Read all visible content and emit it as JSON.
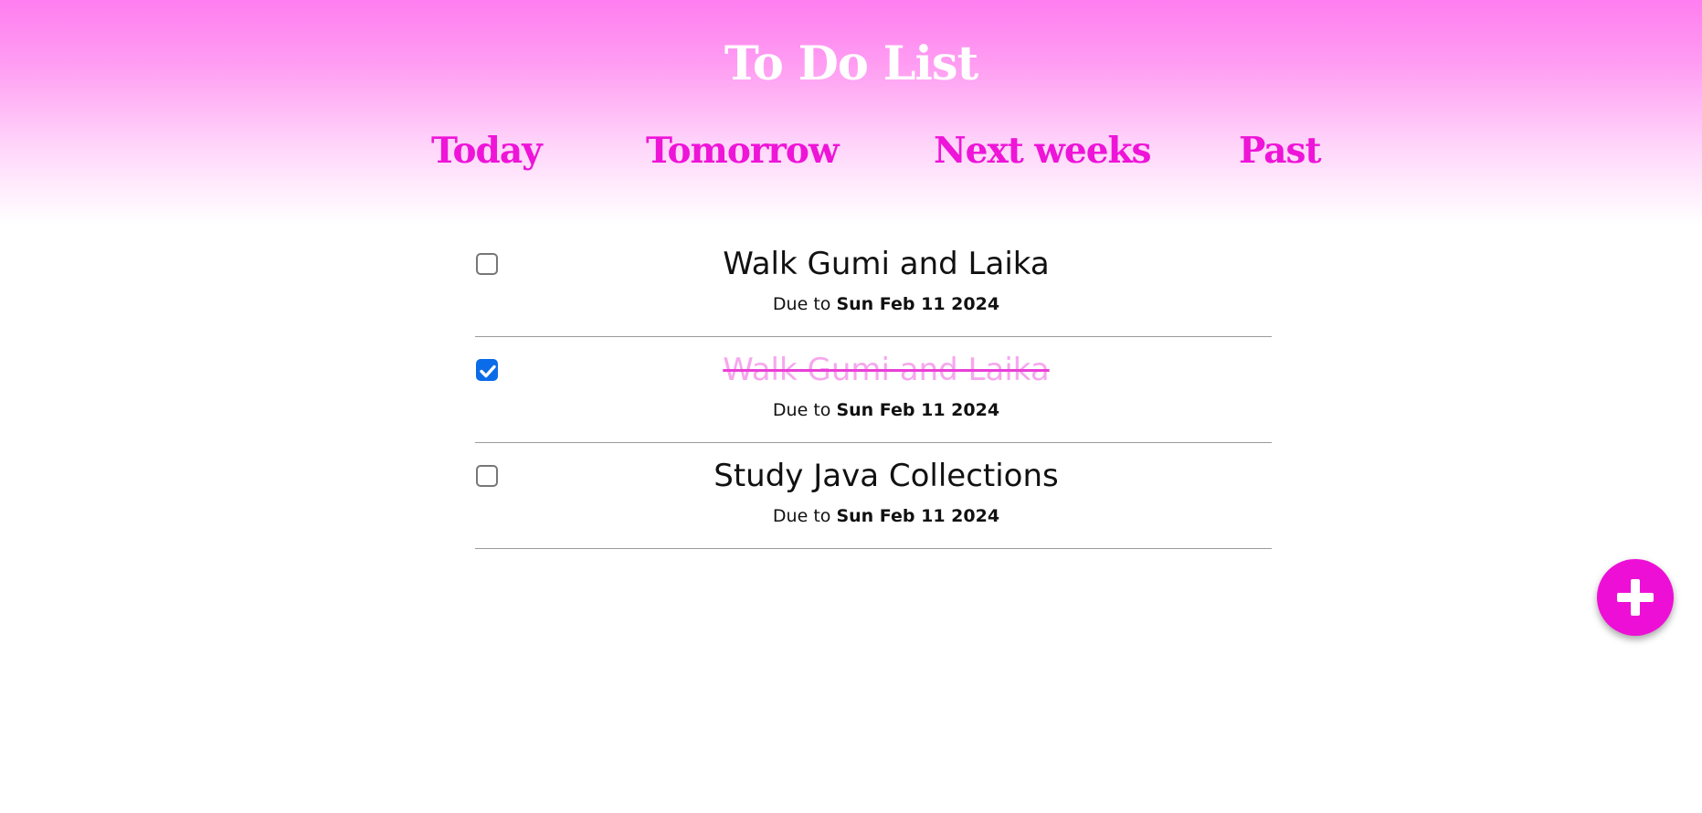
{
  "app": {
    "title": "To Do List"
  },
  "nav": {
    "tabs": [
      {
        "label": "Today"
      },
      {
        "label": "Tomorrow"
      },
      {
        "label": "Next weeks"
      },
      {
        "label": "Past"
      }
    ]
  },
  "tasks": [
    {
      "title": "Walk Gumi and Laika",
      "due_prefix": "Due to",
      "due_date": "Sun Feb 11 2024",
      "completed": false
    },
    {
      "title": "Walk Gumi and Laika",
      "due_prefix": "Due to",
      "due_date": "Sun Feb 11 2024",
      "completed": true
    },
    {
      "title": "Study Java Collections",
      "due_prefix": "Due to",
      "due_date": "Sun Feb 11 2024",
      "completed": false
    }
  ],
  "actions": {
    "add_icon": "plus-icon"
  },
  "colors": {
    "accent": "#ee0fd7",
    "header_top": "#ff7ef0",
    "completed_text": "#f6a7ee",
    "checkbox_checked": "#0a6ce8"
  }
}
